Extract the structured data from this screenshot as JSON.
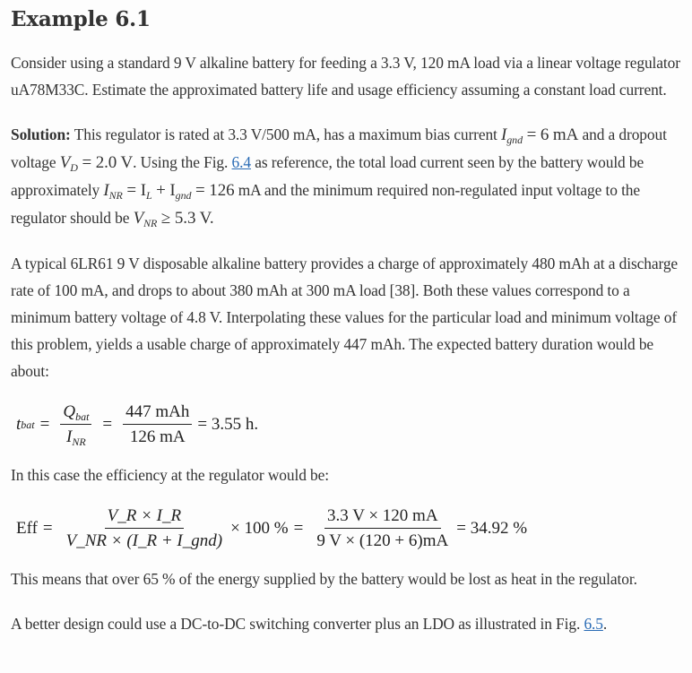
{
  "title": "Example 6.1",
  "intro": "Consider using a standard 9 V alkaline battery for feeding a 3.3 V, 120 mA load via a linear voltage regulator uA78M33C. Estimate the approximated battery life and usage efficiency assuming a constant load current.",
  "solution": {
    "label": "Solution:",
    "t1": " This regulator is rated at 3.3 V/500 mA, has a maximum bias current ",
    "igndval": " = 6 mA",
    "t2": " and a dropout voltage ",
    "vdval": " = 2.0 V",
    "t3": ". Using the Fig. ",
    "fig_ref": "6.4",
    "t4": " as reference, the total load current seen by the battery would be approximately ",
    "inr_eq": " = I",
    "inr_plus": " + I",
    "inr_val": " = 126",
    "t5": " mA and the minimum required non-regulated input voltage to the regulator should be ",
    "vnr_val": " ≥ 5.3 V."
  },
  "para2": "A typical 6LR61 9 V disposable alkaline battery provides a charge of approximately 480 mAh at a discharge rate of 100 mA, and drops to about 380 mAh at 300 mA load [38]. Both these values correspond to a minimum battery voltage of 4.8 V. Interpolating these values for the particular load and minimum voltage of this problem, yields a usable charge of approximately 447 mAh. The expected battery duration would be about:",
  "eq1": {
    "lhs": "t",
    "lhs_sub": "bat",
    "f1_num": "Q",
    "f1_num_sub": "bat",
    "f1_den": "I",
    "f1_den_sub": "NR",
    "f2_num": "447 mAh",
    "f2_den": "126 mA",
    "result": "= 3.55 h."
  },
  "para3": "In this case the efficiency at the regulator would be:",
  "eq2": {
    "lhs": "Eff",
    "f1_num": "V_R × I_R",
    "f1_den": "V_NR × (I_R + I_gnd)",
    "mult": "× 100 %",
    "f2_num": "3.3 V × 120 mA",
    "f2_den": "9 V × (120 + 6)mA",
    "result": "= 34.92 %"
  },
  "para4": "This means that over 65 % of the energy supplied by the battery would be lost as heat in the regulator.",
  "para5": {
    "text": "A better design could use a DC-to-DC switching converter plus an LDO as illustrated in Fig. ",
    "fig_ref": "6.5",
    "end": "."
  },
  "colors": {
    "text": "#333333",
    "link": "#2a6bb5",
    "background": "#fdfdfd"
  }
}
